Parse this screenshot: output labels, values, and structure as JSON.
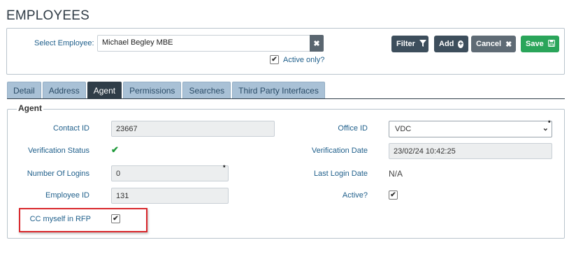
{
  "page": {
    "title": "EMPLOYEES"
  },
  "employee_select": {
    "label": "Select Employee:",
    "value": "Michael Begley MBE",
    "clear_icon": "✖",
    "active_only_label": "Active only?",
    "active_only_checked": true
  },
  "toolbar": {
    "filter_label": "Filter",
    "add_label": "Add",
    "cancel_label": "Cancel",
    "save_label": "Save"
  },
  "tabs": [
    {
      "label": "Detail",
      "active": false
    },
    {
      "label": "Address",
      "active": false
    },
    {
      "label": "Agent",
      "active": true
    },
    {
      "label": "Permissions",
      "active": false
    },
    {
      "label": "Searches",
      "active": false
    },
    {
      "label": "Third Party Interfaces",
      "active": false
    }
  ],
  "agent": {
    "legend": "Agent",
    "contact_id_label": "Contact ID",
    "contact_id": "23667",
    "verification_status_label": "Verification Status",
    "verification_status_icon": "check-icon",
    "number_of_logins_label": "Number Of Logins",
    "number_of_logins": "0",
    "employee_id_label": "Employee ID",
    "employee_id": "131",
    "cc_myself_label": "CC myself in RFP",
    "cc_myself_checked": true,
    "office_id_label": "Office ID",
    "office_id": "VDC",
    "verification_date_label": "Verification Date",
    "verification_date": "23/02/24 10:42:25",
    "last_login_date_label": "Last Login Date",
    "last_login_date": "N/A",
    "active_label": "Active?",
    "active_checked": true,
    "required_marker": "*"
  },
  "colors": {
    "tab_active": "#2f3d48",
    "tab_inactive": "#a9c1d6",
    "label_blue": "#1f5f8b",
    "save_green": "#2aa55a",
    "highlight_red": "#d9262b"
  }
}
